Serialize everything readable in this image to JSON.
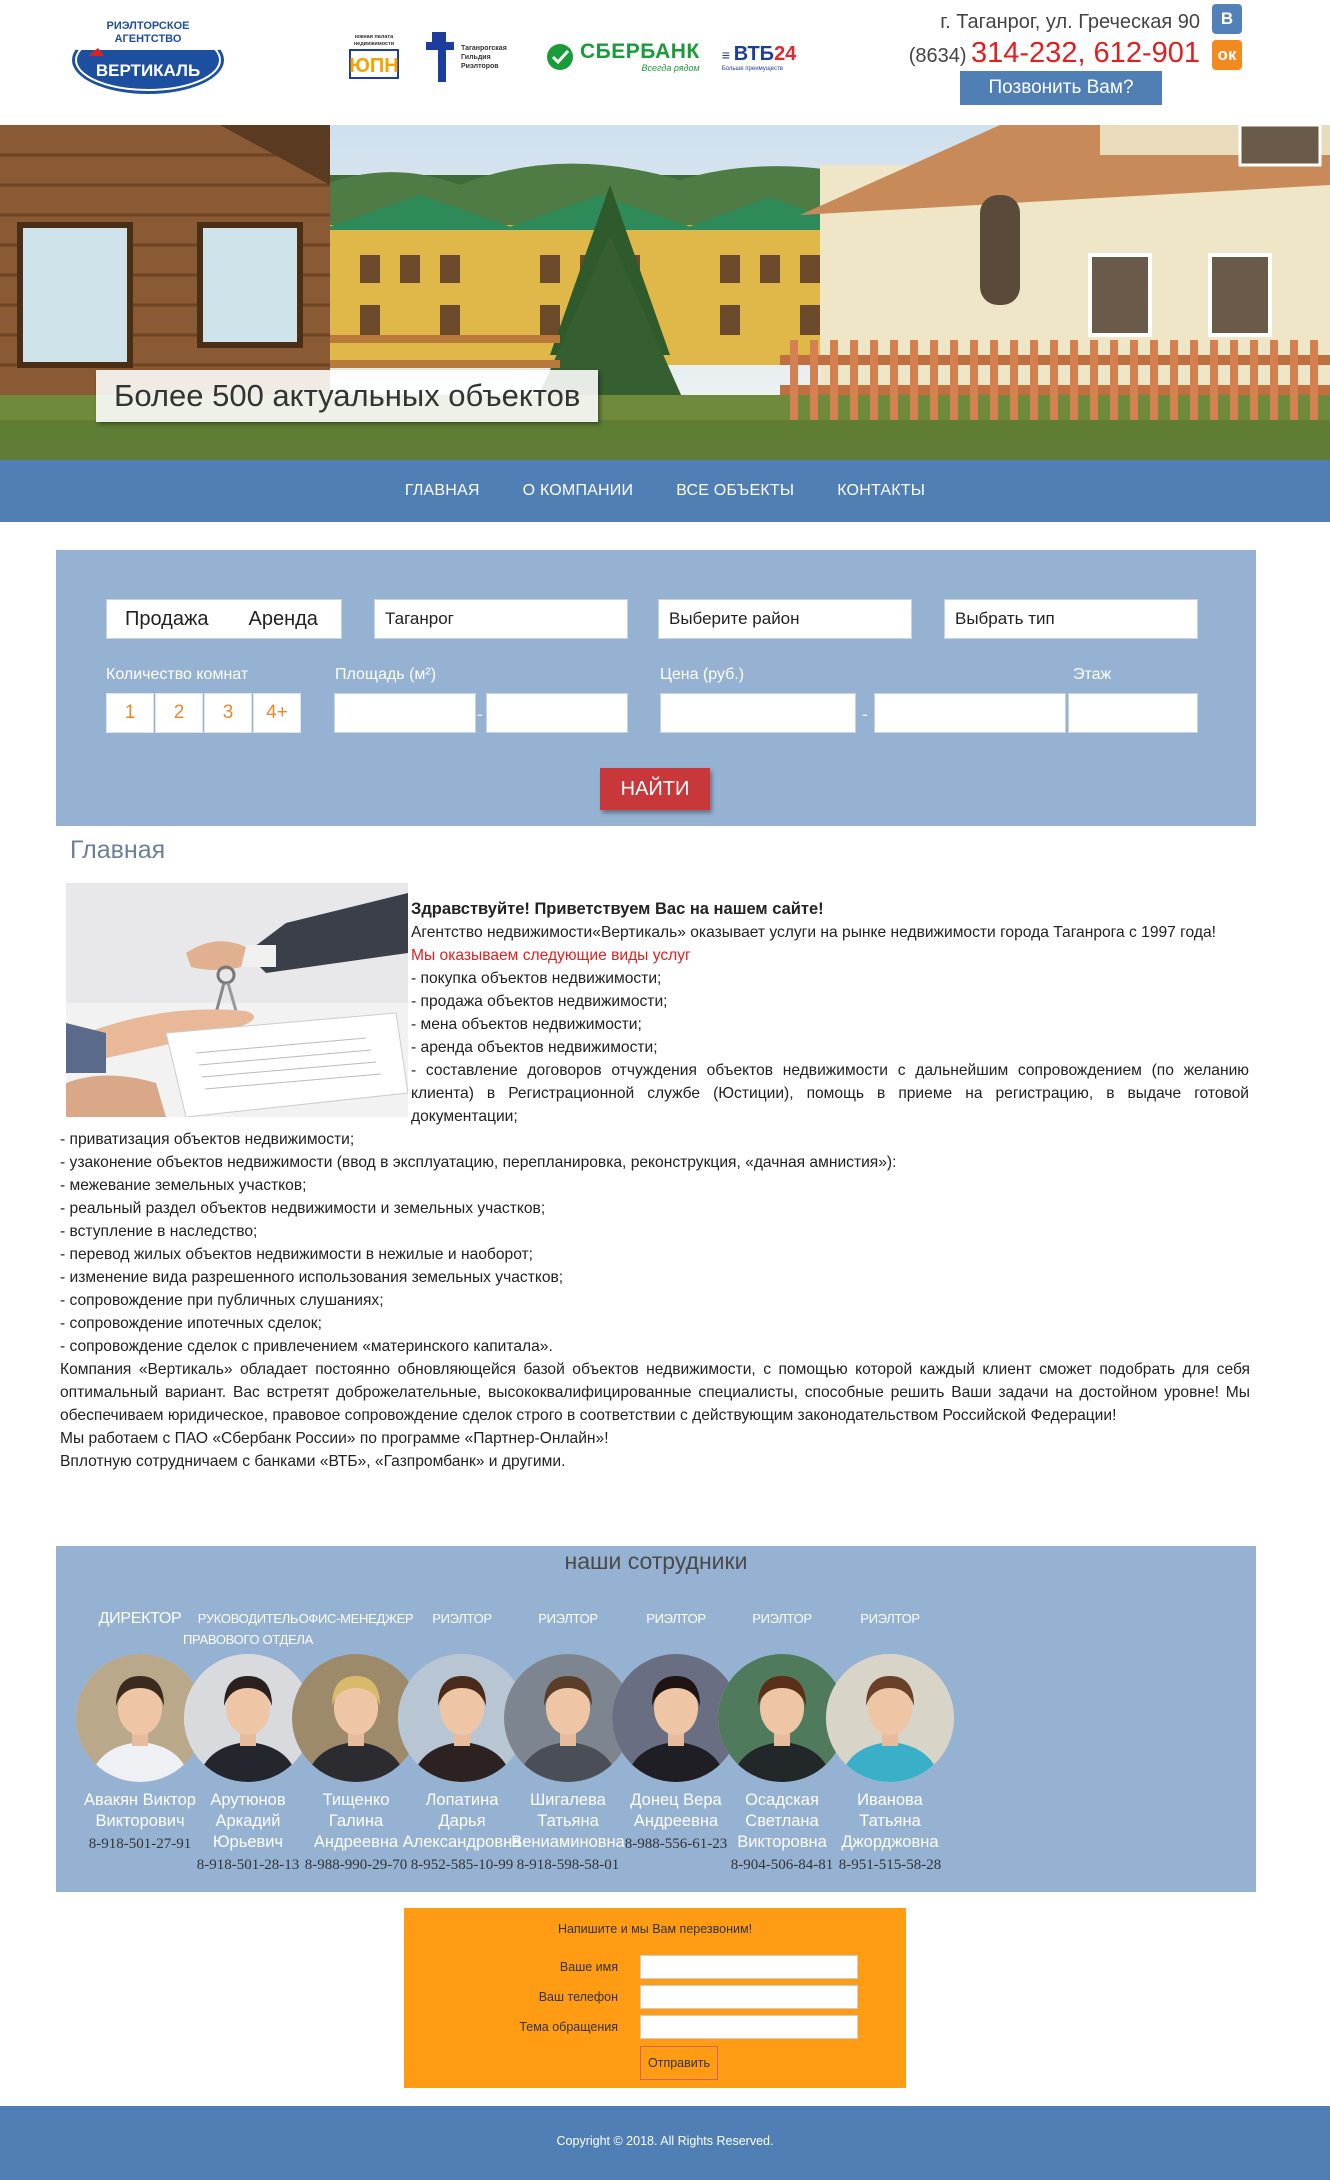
{
  "header": {
    "logo_line1": "РИЭЛТОРСКОЕ",
    "logo_line2": "АГЕНТСТВО",
    "logo_name": "ВЕРТИКАЛЬ",
    "address": "г. Таганрог, ул. Греческая 90",
    "phone_code": "(8634)",
    "phone_numbers": "314-232, 612-901",
    "call_button": "Позвонить Вам?",
    "social": {
      "vk": "В",
      "ok": "ок"
    }
  },
  "partners": {
    "uph": {
      "mark": "ЮПН",
      "caption": "южная палата недвижимости"
    },
    "tgr": {
      "caption": "Таганрогская Гильдия Риэлторов"
    },
    "sber": {
      "name": "СБЕРБАНК",
      "tagline": "Всегда рядом"
    },
    "vtb": {
      "name": "ВТБ",
      "num": "24",
      "tagline": "Больше преимуществ"
    }
  },
  "banner": {
    "caption": "Более 500 актуальных объектов"
  },
  "nav": {
    "items": [
      {
        "label": "ГЛАВНАЯ"
      },
      {
        "label": "О КОМПАНИИ"
      },
      {
        "label": "ВСЕ ОБЪЕКТЫ"
      },
      {
        "label": "КОНТАКТЫ"
      }
    ]
  },
  "search": {
    "deal_sale": "Продажа",
    "deal_rent": "Аренда",
    "city": "Таганрог",
    "district": "Выберите район",
    "type": "Выбрать тип",
    "rooms_label": "Количество комнат",
    "rooms": [
      "1",
      "2",
      "3",
      "4+"
    ],
    "area_label": "Площадь (м²)",
    "price_label": "Цена (руб.)",
    "floor_label": "Этаж",
    "find_button": "НАЙТИ"
  },
  "main": {
    "title": "Главная",
    "greeting": "Здравствуйте! Приветствуем Вас на нашем сайте!",
    "intro": "Агентство недвижимости«Вертикаль» оказывает услуги на рынке недвижимости города Таганрога с 1997 года!",
    "services_heading": "Мы оказываем следующие виды услуг",
    "services_top": [
      "- покупка объектов недвижимости;",
      "- продажа объектов недвижимости;",
      "- мена объектов недвижимости;",
      "- аренда объектов недвижимости;",
      "- составление договоров отчуждения объектов недвижимости с дальнейшим сопровождением (по желанию клиента) в Регистрационной службе (Юстиции), помощь в приеме на регистрацию, в выдаче готовой документации;"
    ],
    "services_more": [
      "- приватизация объектов недвижимости;",
      "- узаконение объектов недвижимости (ввод в эксплуатацию, перепланировка, реконструкция, «дачная амнистия»):",
      "- межевание земельных участков;",
      "- реальный раздел объектов недвижимости и земельных участков;",
      "- вступление в наследство;",
      "- перевод жилых объектов недвижимости в нежилые и наоборот;",
      "- изменение вида разрешенного использования земельных участков;",
      "- сопровождение при публичных слушаниях;",
      "- сопровождение ипотечных сделок;",
      "- сопровождение сделок с привлечением «материнского капитала»."
    ],
    "about": "Компания «Вертикаль» обладает постоянно обновляющейся базой объектов недвижимости, с помощью которой каждый клиент сможет подобрать для себя оптимальный вариант. Вас встретят доброжелательные, высококвалифицированные специалисты, способные решить Ваши задачи на достойном уровне! Мы обеспечиваем юридическое, правовое сопровождение сделок строго в соответствии с действующим законодательством Российской Федерации!",
    "partner_program": "Мы работаем с ПАО «Сбербанк России» по программе «Партнер-Онлайн»!",
    "banks": "Вплотную сотрудничаем с банками «ВТБ», «Газпромбанк» и другими."
  },
  "staff": {
    "title": "наши сотрудники",
    "members": [
      {
        "role": "ДИРЕКТОР",
        "name": "Авакян Виктор Викторович",
        "phone": "8-918-501-27-91",
        "shirt": "#eef0f4",
        "hair": "#3a2a20",
        "bg": "#b9a98a"
      },
      {
        "role": "РУКОВОДИТЕЛЬ ПРАВОВОГО ОТДЕЛА",
        "name": "Арутюнов Аркадий Юрьевич",
        "phone": "8-918-501-28-13",
        "shirt": "#23262c",
        "hair": "#2a2020",
        "bg": "#d8dade"
      },
      {
        "role": "ОФИС-МЕНЕДЖЕР",
        "name": "Тищенко Галина Андреевна",
        "phone": "8-988-990-29-70",
        "shirt": "#2b2b30",
        "hair": "#d9b96a",
        "bg": "#9c8a6a"
      },
      {
        "role": "РИЭЛТОР",
        "name": "Лопатина Дарья Александровна",
        "phone": "8-952-585-10-99",
        "shirt": "#2d2222",
        "hair": "#4a2a1a",
        "bg": "#b8c6d4"
      },
      {
        "role": "РИЭЛТОР",
        "name": "Шигалева Татьяна Вениаминовна",
        "phone": "8-918-598-58-01",
        "shirt": "#4a4e56",
        "hair": "#5a3e2a",
        "bg": "#7d8690"
      },
      {
        "role": "РИЭЛТОР",
        "name": "Донец Вера Андреевна",
        "phone": "8-988-556-61-23",
        "shirt": "#1e1e24",
        "hair": "#1e1414",
        "bg": "#6a6e82"
      },
      {
        "role": "РИЭЛТОР",
        "name": "Осадская Светлана Викторовна",
        "phone": "8-904-506-84-81",
        "shirt": "#22282a",
        "hair": "#5a3018",
        "bg": "#4f7a5c"
      },
      {
        "role": "РИЭЛТОР",
        "name": "Иванова Татьяна Джорджовна",
        "phone": "8-951-515-58-28",
        "shirt": "#3ab0c8",
        "hair": "#6a4028",
        "bg": "#d8d4c8"
      }
    ]
  },
  "callback": {
    "title": "Напишите и мы Вам перезвоним!",
    "name_label": "Ваше имя",
    "phone_label": "Ваш телефон",
    "topic_label": "Тема обращения",
    "submit": "Отправить"
  },
  "footer": {
    "copyright": "Copyright © 2018. All Rights Reserved."
  },
  "colors": {
    "nav": "#4f7fb5",
    "panel": "#96b2d2",
    "accent_red": "#e02020",
    "find_button": "#c8373a",
    "callback": "#ff9c14"
  },
  "icons": [
    "vk-icon",
    "ok-icon",
    "logo-emblem"
  ]
}
